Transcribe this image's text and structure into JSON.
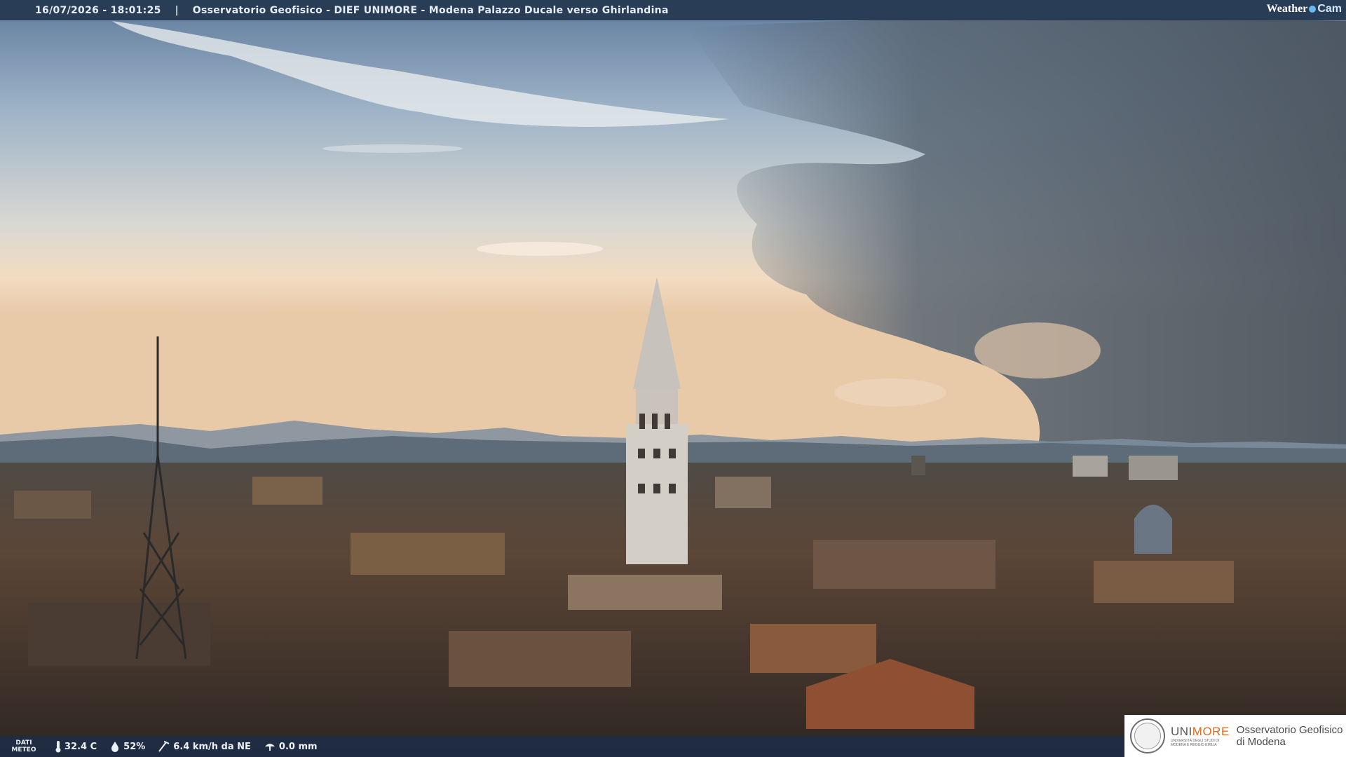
{
  "header": {
    "timestamp": "16/07/2026 - 18:01:25",
    "separator": "|",
    "title": "Osservatorio Geofisico - DIEF UNIMORE - Modena Palazzo Ducale verso Ghirlandina"
  },
  "brand": {
    "weather": "Weather",
    "cam": "Cam",
    "icon": "weathercam-logo"
  },
  "meteo": {
    "label_line1": "DATI",
    "label_line2": "METEO",
    "items": [
      {
        "icon": "thermometer-icon",
        "value": "32.4 C"
      },
      {
        "icon": "humidity-icon",
        "value": "52%"
      },
      {
        "icon": "wind-icon",
        "value": "6.4 km/h da NE"
      },
      {
        "icon": "rain-icon",
        "value": "0.0 mm"
      }
    ]
  },
  "institution": {
    "name_prefix": "UNI",
    "name_suffix": "MORE",
    "subtitle": "UNIVERSITÀ DEGLI STUDI DI MODENA E REGGIO EMILIA",
    "observatory_line1": "Osservatorio Geofisico",
    "observatory_line2": "di Modena"
  },
  "colors": {
    "accent": "#e2661d",
    "bar": "#243750",
    "sky_top": "#6d88a6",
    "sky_glow": "#f2d9bd"
  }
}
